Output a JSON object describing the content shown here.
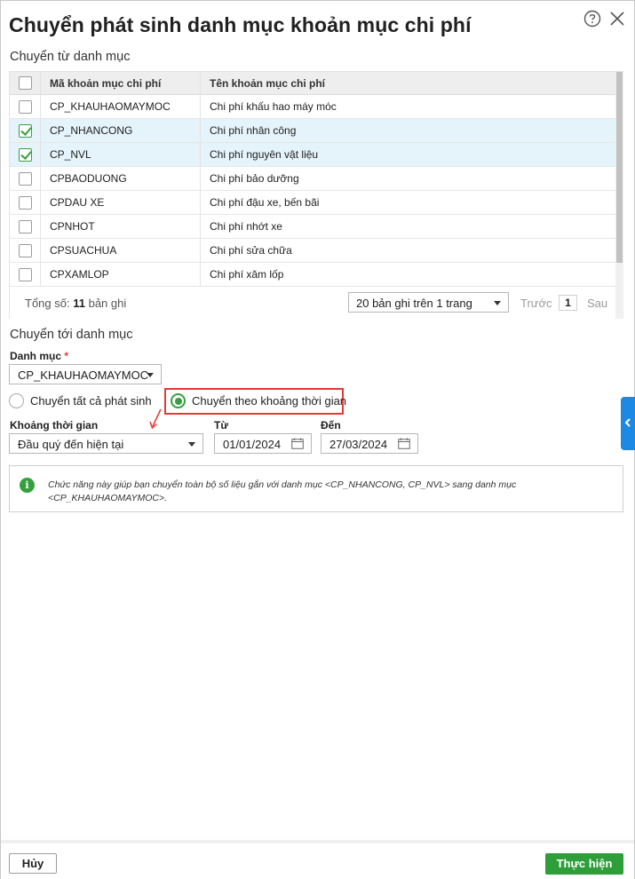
{
  "dialog": {
    "title": "Chuyển phát sinh danh mục khoản mục chi phí"
  },
  "source": {
    "section_label": "Chuyển từ danh mục",
    "columns": [
      "Mã khoản mục chi phí",
      "Tên khoản mục chi phí"
    ],
    "rows": [
      {
        "code": "CP_KHAUHAOMAYMOC",
        "name": "Chi phí khấu hao máy móc",
        "checked": false
      },
      {
        "code": "CP_NHANCONG",
        "name": "Chi phí nhân công",
        "checked": true
      },
      {
        "code": "CP_NVL",
        "name": "Chi phí nguyên vật liệu",
        "checked": true
      },
      {
        "code": "CPBAODUONG",
        "name": "Chi phí bảo dưỡng",
        "checked": false
      },
      {
        "code": "CPDAU XE",
        "name": "Chi phí đậu xe, bến bãi",
        "checked": false
      },
      {
        "code": "CPNHOT",
        "name": "Chi phí nhớt xe",
        "checked": false
      },
      {
        "code": "CPSUACHUA",
        "name": "Chi phí sửa chữa",
        "checked": false
      },
      {
        "code": "CPXAMLOP",
        "name": "Chi phí xăm lốp",
        "checked": false
      }
    ],
    "pager": {
      "total_prefix": "Tổng số:",
      "total_count": "11",
      "total_suffix": "bản ghi",
      "page_size": "20 bản ghi trên 1 trang",
      "prev": "Trước",
      "page": "1",
      "next": "Sau"
    }
  },
  "target": {
    "section_label": "Chuyển tới danh mục",
    "category_label": "Danh mục",
    "required_mark": "*",
    "category_value": "CP_KHAUHAOMAYMOC",
    "radio_all": "Chuyển tất cả phát sinh",
    "radio_period": "Chuyển theo khoảng thời gian",
    "period_label": "Khoảng thời gian",
    "period_value": "Đầu quý đến hiện tại",
    "from_label": "Từ",
    "from_value": "01/01/2024",
    "to_label": "Đến",
    "to_value": "27/03/2024"
  },
  "info": {
    "message": "Chức năng này giúp bạn chuyển toàn bộ số liệu gắn với danh mục <CP_NHANCONG, CP_NVL> sang danh mục <CP_KHAUHAOMAYMOC>."
  },
  "footer": {
    "cancel_label": "Hủy",
    "submit_label": "Thực hiện"
  },
  "colors": {
    "accent_green": "#2e9e3a",
    "highlight_red": "#e53935",
    "side_tab_blue": "#1e88e5",
    "selected_row": "#e5f3fb"
  },
  "icons": [
    "help-icon",
    "close-icon",
    "checkbox",
    "radio",
    "calendar-icon",
    "info-icon",
    "chevron-left-icon",
    "chevron-down-icon"
  ]
}
